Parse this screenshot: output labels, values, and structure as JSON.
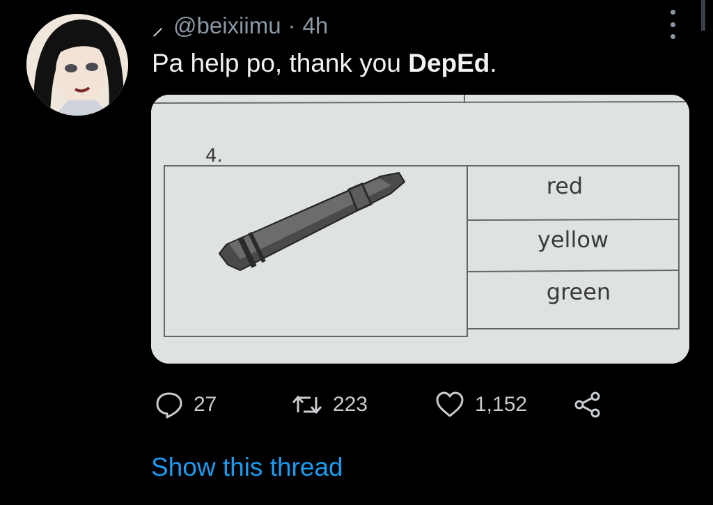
{
  "tweet": {
    "handle": "@beixiimu",
    "separator": "·",
    "time": "4h",
    "text_prefix": "Pa help po, thank you ",
    "text_bold": "DepEd",
    "text_suffix": "."
  },
  "worksheet": {
    "item_number": "4.",
    "choices": [
      "red",
      "yellow",
      "green"
    ]
  },
  "actions": {
    "replies": "27",
    "retweets": "223",
    "likes": "1,152"
  },
  "show_thread_label": "Show this thread",
  "colors": {
    "background": "#000000",
    "link": "#1d9bf0",
    "muted": "#8b98a5",
    "text": "#e7e9ea"
  },
  "icons": [
    "name-mark-icon",
    "more-options-icon",
    "reply-icon",
    "retweet-icon",
    "like-icon",
    "share-icon"
  ]
}
